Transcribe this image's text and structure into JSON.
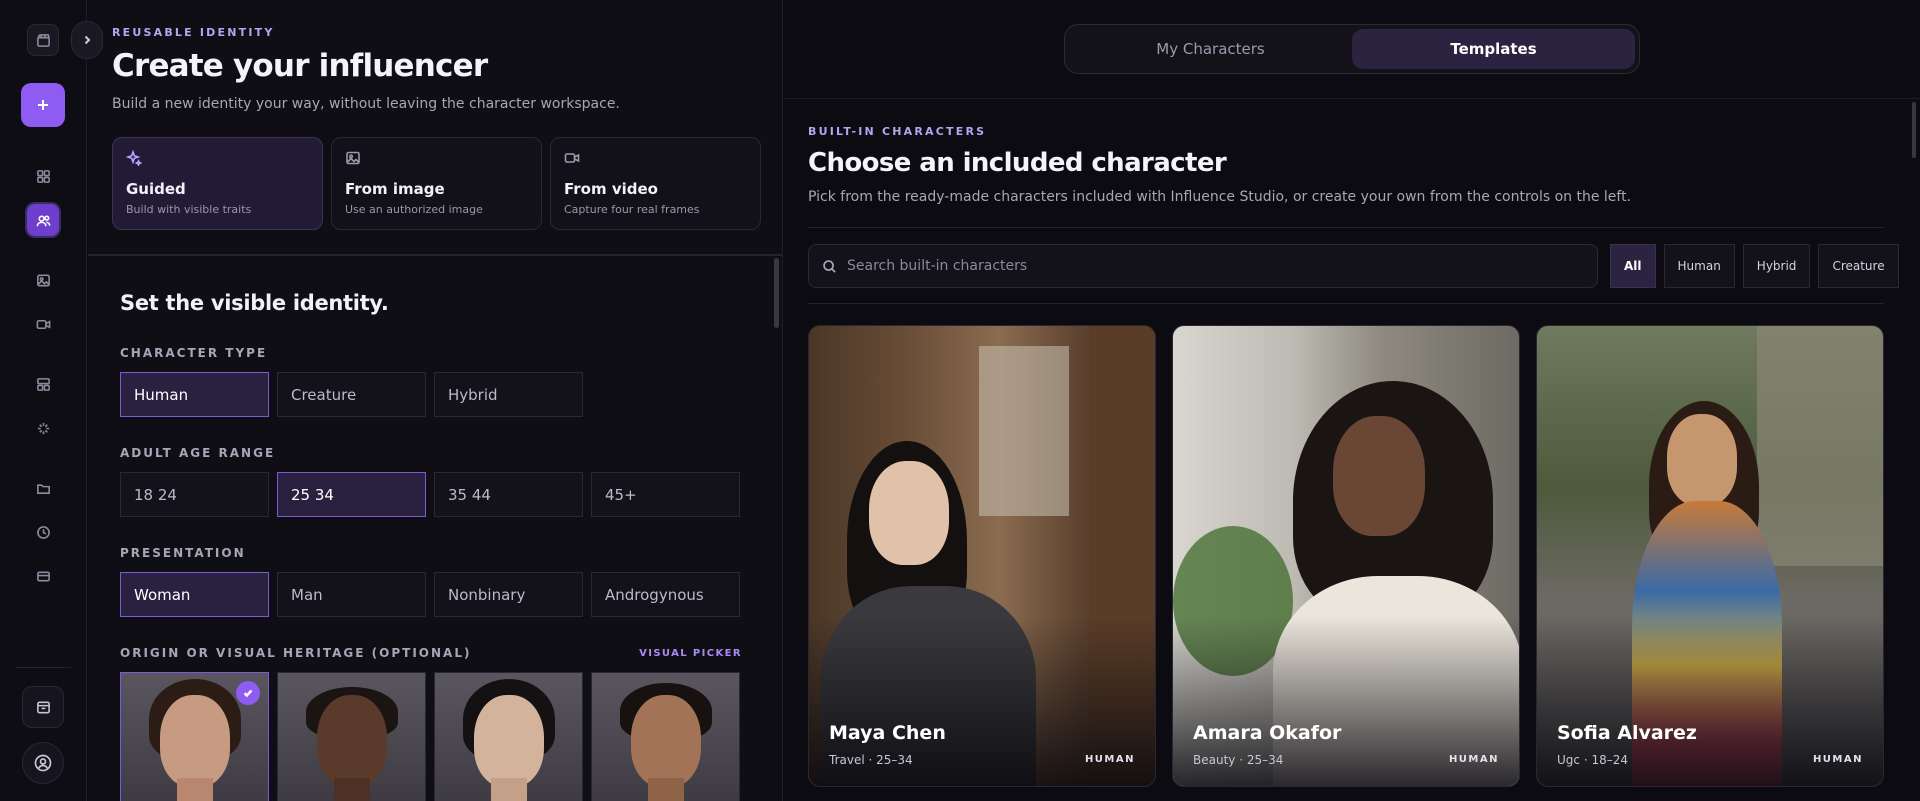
{
  "sidebar": {
    "icons": [
      "clapperboard-icon",
      "grid-icon",
      "users-icon",
      "image-icon",
      "video-icon",
      "layout-icon",
      "sparkle-icon",
      "folder-icon",
      "clock-icon",
      "card-icon"
    ]
  },
  "left": {
    "eyebrow": "REUSABLE IDENTITY",
    "title": "Create your influencer",
    "subtitle": "Build a new identity your way, without leaving the character workspace.",
    "modes": [
      {
        "title": "Guided",
        "sub": "Build with visible traits",
        "icon": "sparkle-icon"
      },
      {
        "title": "From image",
        "sub": "Use an authorized image",
        "icon": "image-icon"
      },
      {
        "title": "From video",
        "sub": "Capture four real frames",
        "icon": "video-icon"
      }
    ],
    "section_title": "Set the visible identity.",
    "character_type": {
      "label": "CHARACTER TYPE",
      "options": [
        "Human",
        "Creature",
        "Hybrid"
      ],
      "selected": "Human"
    },
    "age_range": {
      "label": "ADULT AGE RANGE",
      "options": [
        "18 24",
        "25 34",
        "35 44",
        "45+"
      ],
      "selected": "25 34"
    },
    "presentation": {
      "label": "PRESENTATION",
      "options": [
        "Woman",
        "Man",
        "Nonbinary",
        "Androgynous"
      ],
      "selected": "Woman"
    },
    "heritage": {
      "label": "ORIGIN OR VISUAL HERITAGE (OPTIONAL)",
      "link": "VISUAL PICKER"
    }
  },
  "right": {
    "tabs": [
      "My Characters",
      "Templates"
    ],
    "active_tab": "Templates",
    "eyebrow": "BUILT-IN CHARACTERS",
    "title": "Choose an included character",
    "subtitle": "Pick from the ready-made characters included with Influence Studio, or create your own from the controls on the left.",
    "search_placeholder": "Search built-in characters",
    "filters": [
      "All",
      "Human",
      "Hybrid",
      "Creature"
    ],
    "active_filter": "All",
    "cards": [
      {
        "name": "Maya Chen",
        "meta": "Travel · 25–34",
        "tag": "HUMAN"
      },
      {
        "name": "Amara Okafor",
        "meta": "Beauty · 25–34",
        "tag": "HUMAN"
      },
      {
        "name": "Sofia Alvarez",
        "meta": "Ugc · 18–24",
        "tag": "HUMAN"
      }
    ]
  },
  "colors": {
    "accent": "#8e5cf2",
    "selected_bg": "#2a2040",
    "selected_border": "#7b5ad6",
    "eyebrow": "#b8a3f0"
  }
}
